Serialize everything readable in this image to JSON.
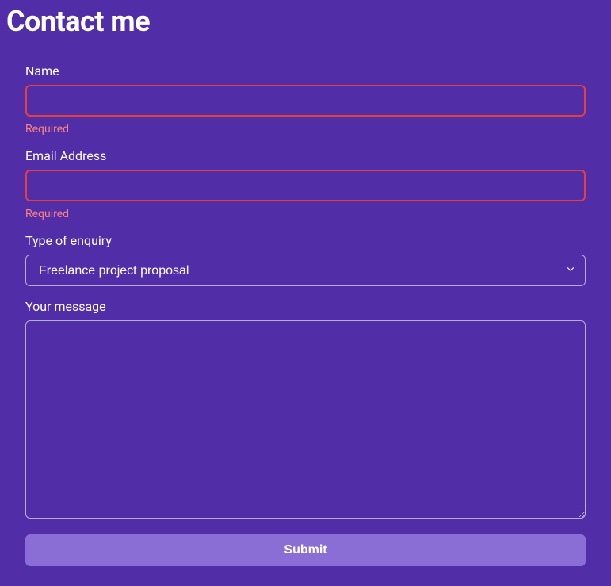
{
  "title": "Contact me",
  "form": {
    "name": {
      "label": "Name",
      "value": "",
      "error": "Required"
    },
    "email": {
      "label": "Email Address",
      "value": "",
      "error": "Required"
    },
    "enquiryType": {
      "label": "Type of enquiry",
      "selected": "Freelance project proposal"
    },
    "message": {
      "label": "Your message",
      "value": ""
    },
    "submitLabel": "Submit"
  }
}
